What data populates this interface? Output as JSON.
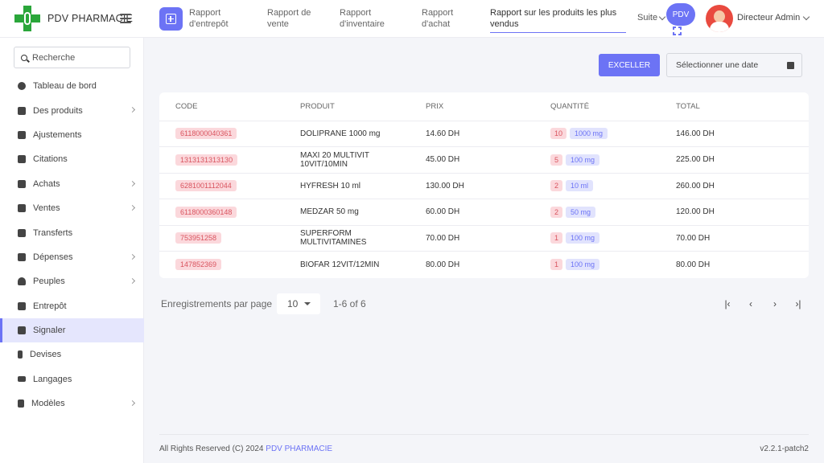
{
  "brand": {
    "name": "PDV PHARMACIE"
  },
  "header": {
    "tabs": [
      {
        "line1": "Rapport",
        "line2": "d'entrepôt"
      },
      {
        "line1": "Rapport de",
        "line2": "vente"
      },
      {
        "line1": "Rapport",
        "line2": "d'inventaire"
      },
      {
        "line1": "Rapport",
        "line2": "d'achat"
      },
      {
        "line1": "Rapport sur les produits les plus",
        "line2": "vendus"
      }
    ],
    "suite_label": "Suite",
    "pdv_label": "PDV",
    "user_name": "Directeur Admin"
  },
  "sidebar": {
    "search_placeholder": "Recherche",
    "items": [
      {
        "label": "Tableau de bord",
        "icon": "pie-chart-icon"
      },
      {
        "label": "Des produits",
        "icon": "boxes-icon"
      },
      {
        "label": "Ajustements",
        "icon": "adjust-icon"
      },
      {
        "label": "Citations",
        "icon": "basket-icon"
      },
      {
        "label": "Achats",
        "icon": "receipt-icon"
      },
      {
        "label": "Ventes",
        "icon": "cart-icon"
      },
      {
        "label": "Transferts",
        "icon": "transfer-icon"
      },
      {
        "label": "Dépenses",
        "icon": "money-icon"
      },
      {
        "label": "Peuples",
        "icon": "user-icon"
      },
      {
        "label": "Entrepôt",
        "icon": "home-icon"
      },
      {
        "label": "Signaler",
        "icon": "report-chart-icon"
      },
      {
        "label": "Devises",
        "icon": "dollar-icon"
      },
      {
        "label": "Langages",
        "icon": "language-icon"
      },
      {
        "label": "Modèles",
        "icon": "file-icon"
      }
    ]
  },
  "toolbar": {
    "excel_label": "EXCELLER",
    "date_placeholder": "Sélectionner une date"
  },
  "table": {
    "headers": [
      "CODE",
      "PRODUIT",
      "PRIX",
      "QUANTITÉ",
      "TOTAL"
    ],
    "rows": [
      {
        "code": "6118000040361",
        "product": "DOLIPRANE 1000 mg",
        "price": "14.60 DH",
        "qty": "10",
        "unit": "1000 mg",
        "total": "146.00 DH"
      },
      {
        "code": "1313131313130",
        "product": "MAXI 20 MULTIVIT 10VIT/10MIN",
        "price": "45.00 DH",
        "qty": "5",
        "unit": "100 mg",
        "total": "225.00 DH"
      },
      {
        "code": "6281001112044",
        "product": "HYFRESH 10 ml",
        "price": "130.00 DH",
        "qty": "2",
        "unit": "10 ml",
        "total": "260.00 DH"
      },
      {
        "code": "6118000360148",
        "product": "MEDZAR 50 mg",
        "price": "60.00 DH",
        "qty": "2",
        "unit": "50 mg",
        "total": "120.00 DH"
      },
      {
        "code": "753951258",
        "product": "SUPERFORM MULTIVITAMINES",
        "price": "70.00 DH",
        "qty": "1",
        "unit": "100 mg",
        "total": "70.00 DH"
      },
      {
        "code": "147852369",
        "product": "BIOFAR 12VIT/12MIN",
        "price": "80.00 DH",
        "qty": "1",
        "unit": "100 mg",
        "total": "80.00 DH"
      }
    ]
  },
  "pagination": {
    "per_page_label": "Enregistrements par page",
    "per_page_value": "10",
    "range": "1-6 of 6",
    "first": "|‹",
    "prev": "‹",
    "next": "›",
    "last": "›|"
  },
  "footer": {
    "copyright": "All Rights Reserved (C) 2024",
    "brand": "PDV PHARMACIE",
    "version": "v2.2.1-patch2"
  },
  "colors": {
    "accent": "#6c73f5",
    "badge_red_bg": "#fbd8dc",
    "badge_blue_bg": "#e1e3fd",
    "logo_green": "#2aa63a"
  }
}
